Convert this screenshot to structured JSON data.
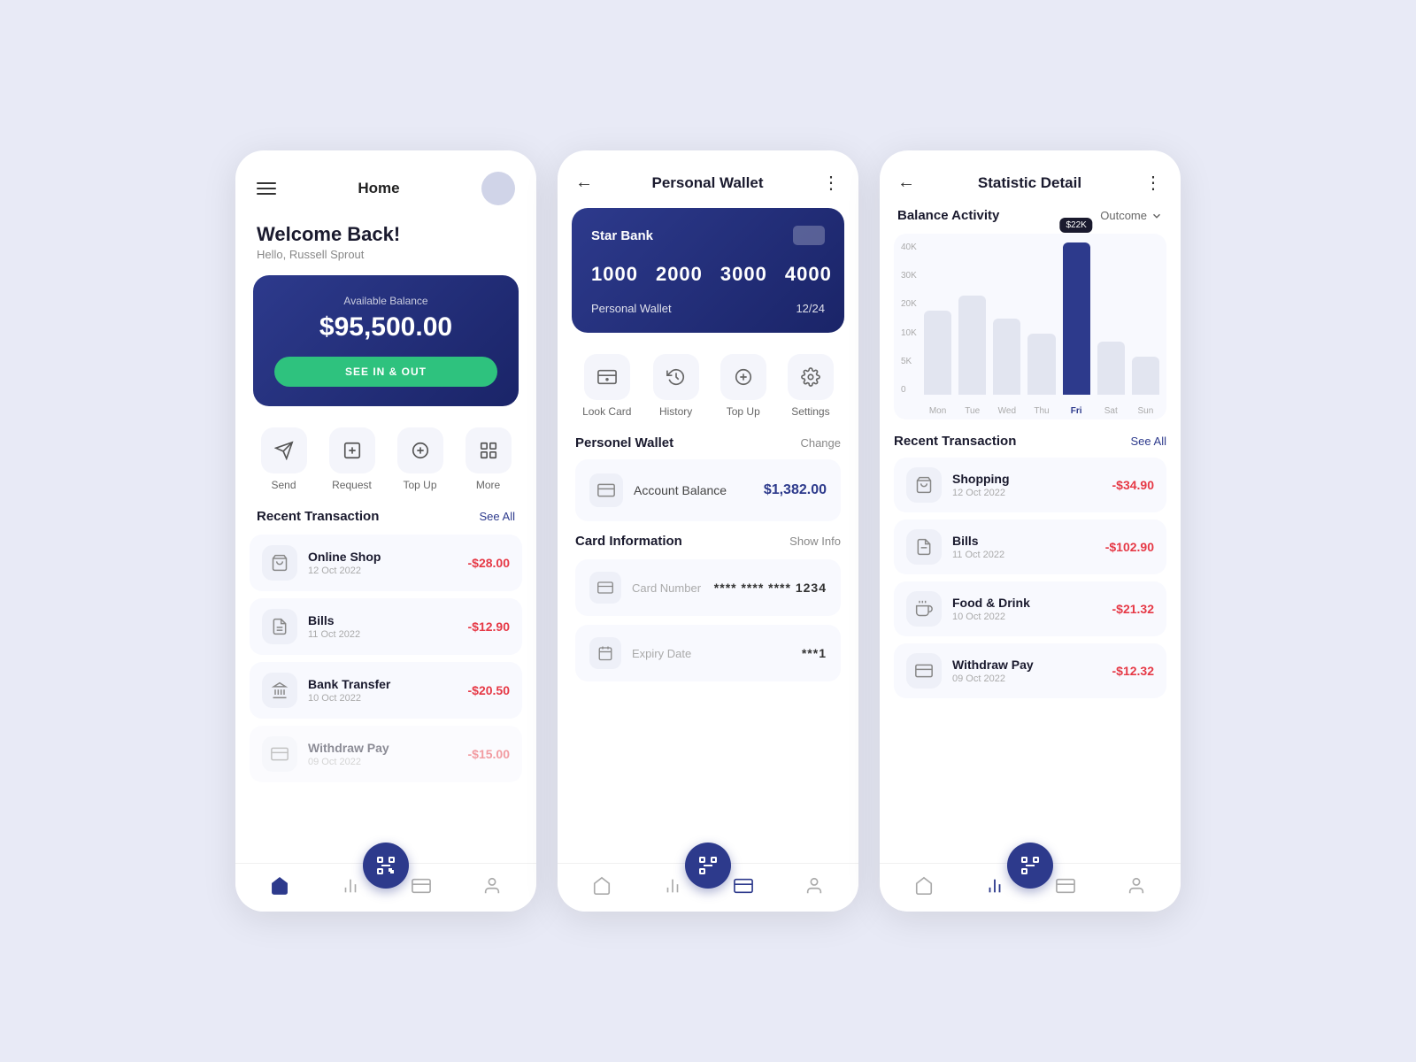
{
  "screen1": {
    "title": "Home",
    "welcome": "Welcome Back!",
    "greeting": "Hello, Russell Sprout",
    "balance_label": "Available Balance",
    "balance": "$95,500.00",
    "see_btn": "SEE IN & OUT",
    "actions": [
      {
        "label": "Send",
        "icon": "send"
      },
      {
        "label": "Request",
        "icon": "request"
      },
      {
        "label": "Top Up",
        "icon": "topup"
      },
      {
        "label": "More",
        "icon": "more"
      }
    ],
    "recent_title": "Recent Transaction",
    "see_all": "See All",
    "transactions": [
      {
        "name": "Online Shop",
        "date": "12 Oct 2022",
        "amount": "-$28.00",
        "icon": "shop"
      },
      {
        "name": "Bills",
        "date": "11 Oct 2022",
        "amount": "-$12.90",
        "icon": "bill"
      },
      {
        "name": "Bank Transfer",
        "date": "10 Oct 2022",
        "amount": "-$20.50",
        "icon": "bank"
      },
      {
        "name": "Withdraw Pay",
        "date": "09 Oct 2022",
        "amount": "-$15.00",
        "icon": "withdraw"
      }
    ]
  },
  "screen2": {
    "title": "Personal Wallet",
    "card": {
      "bank": "Star Bank",
      "numbers": [
        "1000",
        "2000",
        "3000",
        "4000"
      ],
      "wallet_label": "Personal Wallet",
      "expiry": "12/24"
    },
    "actions": [
      {
        "label": "Look Card",
        "icon": "lookcard"
      },
      {
        "label": "History",
        "icon": "history"
      },
      {
        "label": "Top Up",
        "icon": "topup"
      },
      {
        "label": "Settings",
        "icon": "settings"
      }
    ],
    "personel_wallet": "Personel Wallet",
    "change": "Change",
    "account_balance_label": "Account Balance",
    "account_balance": "$1,382.00",
    "card_info_title": "Card Information",
    "show_info": "Show Info",
    "card_number_label": "Card Number",
    "card_number_value": "**** **** **** 1234",
    "expiry_label": "Expiry Date",
    "expiry_value": "***1"
  },
  "screen3": {
    "title": "Statistic Detail",
    "balance_activity": "Balance Activity",
    "outcome": "Outcome",
    "chart": {
      "y_labels": [
        "40K",
        "30K",
        "20K",
        "10K",
        "5K",
        "0"
      ],
      "x_labels": [
        "Mon",
        "Tue",
        "Wed",
        "Thu",
        "Fri",
        "Sat",
        "Sun"
      ],
      "bars": [
        55,
        65,
        50,
        40,
        100,
        35,
        25
      ],
      "active_index": 4,
      "tooltip": "$22K",
      "tooltip_index": 4
    },
    "recent_title": "Recent Transaction",
    "see_all": "See All",
    "transactions": [
      {
        "name": "Shopping",
        "date": "12 Oct 2022",
        "amount": "-$34.90",
        "icon": "shop"
      },
      {
        "name": "Bills",
        "date": "11 Oct 2022",
        "amount": "-$102.90",
        "icon": "bill"
      },
      {
        "name": "Food & Drink",
        "date": "10 Oct 2022",
        "amount": "-$21.32",
        "icon": "food"
      },
      {
        "name": "Withdraw Pay",
        "date": "09 Oct 2022",
        "amount": "-$12.32",
        "icon": "withdraw"
      }
    ]
  },
  "colors": {
    "primary": "#2d3a8c",
    "green": "#2ec27e",
    "red": "#e63946",
    "bg": "#e8eaf6"
  }
}
